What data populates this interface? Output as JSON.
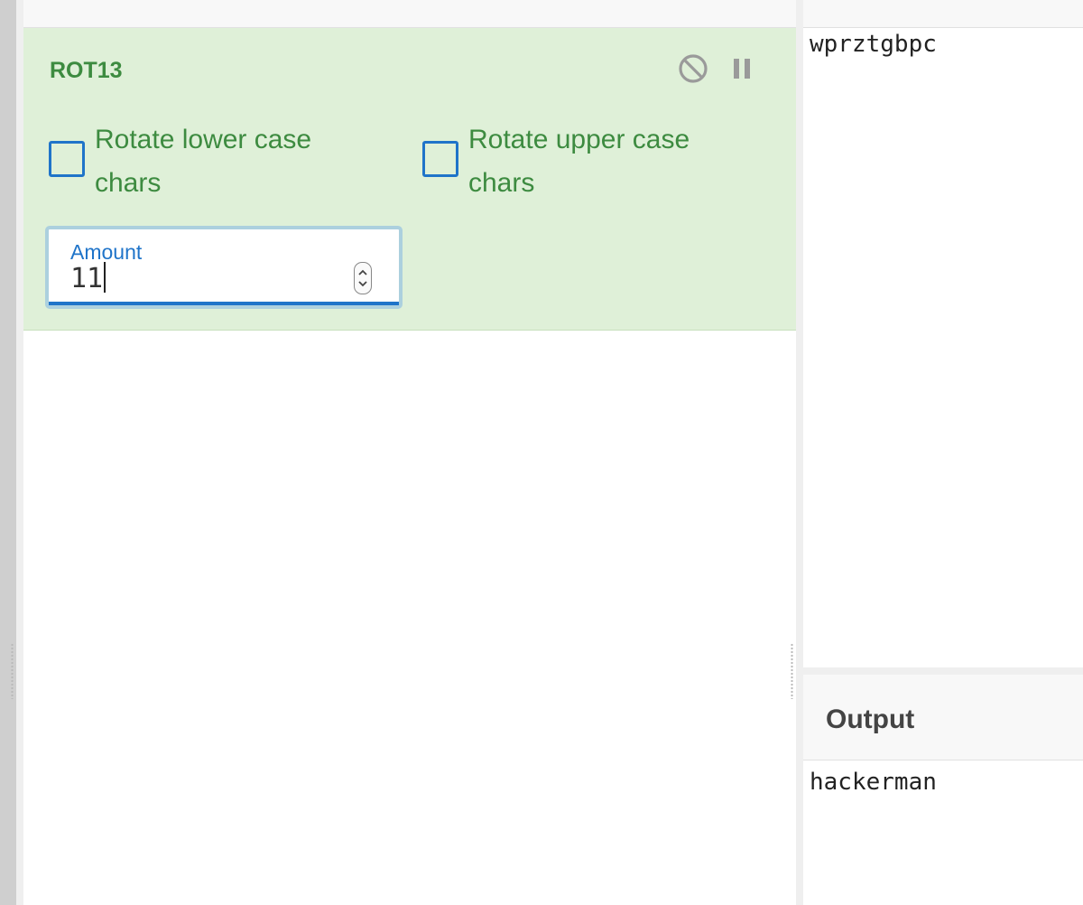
{
  "operation": {
    "title": "ROT13",
    "disable_icon": "disable-icon",
    "pause_icon": "pause-icon",
    "options": [
      {
        "label": "Rotate lower case chars",
        "checked": false
      },
      {
        "label": "Rotate upper case chars",
        "checked": false
      }
    ],
    "amount": {
      "label": "Amount",
      "value": "11"
    }
  },
  "input": {
    "text": "wprztgbpc"
  },
  "output": {
    "title": "Output",
    "text": "hackerman"
  },
  "colors": {
    "operation_bg": "#dff0d8",
    "operation_text": "#3d8b40",
    "accent": "#1f74c9"
  }
}
